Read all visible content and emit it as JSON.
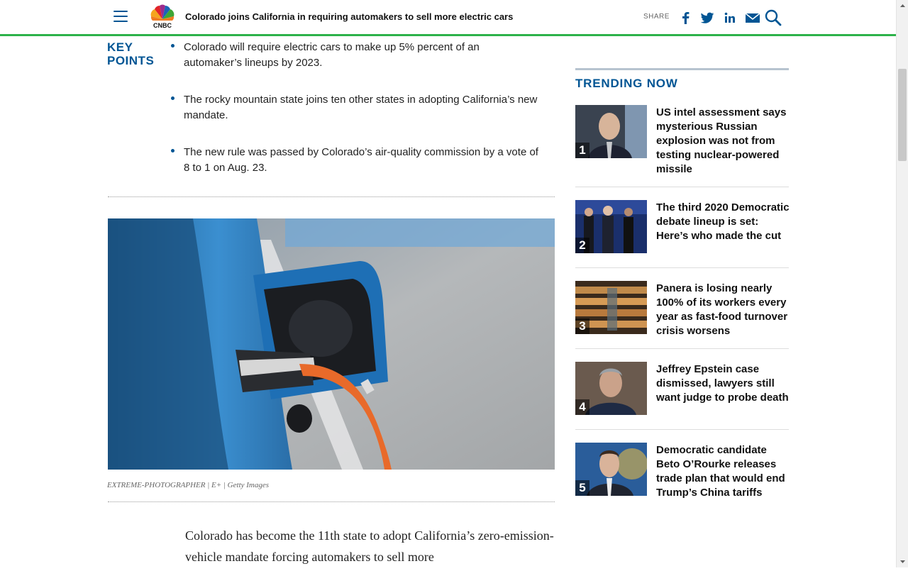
{
  "header": {
    "headline": "Colorado joins California in requiring automakers to sell more electric cars",
    "share_label": "SHARE",
    "logo_text": "CNBC"
  },
  "key_points": {
    "title_line1": "KEY",
    "title_line2": "POINTS",
    "items": [
      "Colorado will require electric cars to make up 5% percent of an automaker’s lineups by 2023.",
      "The rocky mountain state joins ten other states in adopting California’s new mandate.",
      "The new rule was passed by Colorado’s air-quality commission by a vote of 8 to 1 on Aug. 23."
    ]
  },
  "photo": {
    "caption": "EXTREME-PHOTOGRAPHER | E+ | Getty Images"
  },
  "article": {
    "body": "Colorado has become the 11th state to adopt California’s zero-emission-vehicle mandate forcing automakers to sell more"
  },
  "trending": {
    "title": "TRENDING NOW",
    "items": [
      {
        "num": "1",
        "text": "US intel assessment says mysterious Russian explosion was not from testing nuclear-powered missile"
      },
      {
        "num": "2",
        "text": "The third 2020 Democratic debate lineup is set: Here’s who made the cut"
      },
      {
        "num": "3",
        "text": "Panera is losing nearly 100% of its workers every year as fast-food turnover crisis worsens"
      },
      {
        "num": "4",
        "text": "Jeffrey Epstein case dismissed, lawyers still want judge to probe death"
      },
      {
        "num": "5",
        "text": "Democratic candidate Beto O’Rourke releases trade plan that would end Trump’s China tariffs"
      }
    ]
  },
  "colors": {
    "brand_blue": "#005594",
    "header_rule": "#2db24a"
  }
}
